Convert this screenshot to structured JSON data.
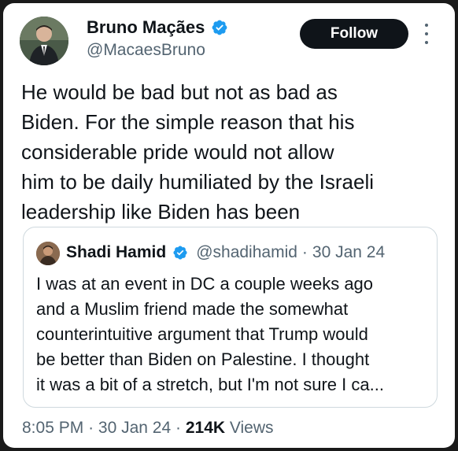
{
  "author": {
    "name": "Bruno Maçães",
    "handle": "@MacaesBruno",
    "verified": true
  },
  "follow_button": {
    "label": "Follow"
  },
  "more_icon": "more-vertical-icon",
  "tweet": {
    "text": "He would be bad but not as bad as\nBiden. For the simple reason that his\nconsiderable pride would not allow\nhim to be daily humiliated by the Israeli\nleadership like Biden has been"
  },
  "quote": {
    "name": "Shadi Hamid",
    "handle": "@shadihamid",
    "separator": "·",
    "date": "30 Jan 24",
    "text": "I was at an event in DC a couple weeks ago\nand a Muslim friend made the somewhat\ncounterintuitive argument that Trump would\nbe better than Biden on Palestine. I thought\nit was a bit of a stretch, but I'm not sure I ca..."
  },
  "footer": {
    "time": "8:05 PM",
    "sep1": "·",
    "date": "30 Jan 24",
    "sep2": "·",
    "views_count": "214K",
    "views_label": "Views"
  },
  "colors": {
    "text_primary": "#0f1419",
    "text_secondary": "#536471",
    "verified_blue": "#1d9bf0",
    "border": "#cfd9de",
    "button_bg": "#0f1419"
  }
}
